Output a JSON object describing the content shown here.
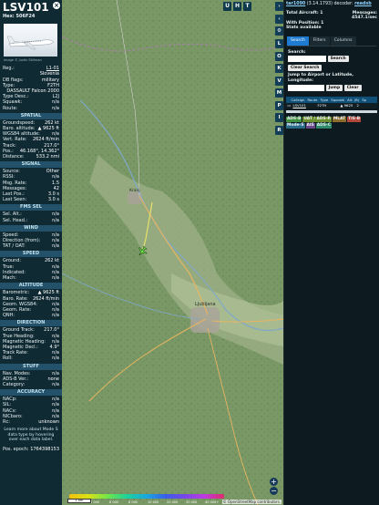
{
  "aircraft": {
    "callsign": "LSV101",
    "hex_line": "Hex: 506F24",
    "photo_credit": "Image © Justin Stillman",
    "reg_label": "Reg.:",
    "reg": "L1-01",
    "country": "Slovenia",
    "dbflags_label": "DB flags:",
    "dbflags": "military",
    "type_label": "Type:",
    "type": "F2TH",
    "model": "DASSAULT Falcon 2000",
    "typedesc_label": "Type Desc.:",
    "typedesc": "L2J",
    "squawk_label": "Squawk:",
    "squawk": "n/a",
    "route_label": "Route:",
    "route": "n/a"
  },
  "spatial": {
    "title": "SPATIAL",
    "rows": [
      {
        "k": "Groundspeed:",
        "v": "262 kt"
      },
      {
        "k": "Baro. altitude:",
        "v": "▲ 9625 ft"
      },
      {
        "k": "WGS84 altitude:",
        "v": "n/a"
      },
      {
        "k": "Vert. Rate:",
        "v": "2624 ft/min"
      },
      {
        "k": "Track:",
        "v": "217.0°"
      },
      {
        "k": "Pos.:",
        "v": "46.168°, 14.362°"
      },
      {
        "k": "Distance:",
        "v": "533.2 nmi"
      }
    ]
  },
  "signal": {
    "title": "SIGNAL",
    "rows": [
      {
        "k": "Source:",
        "v": "Other"
      },
      {
        "k": "RSSI:",
        "v": "n/a"
      },
      {
        "k": "Msg. Rate:",
        "v": "1.5"
      },
      {
        "k": "Messages:",
        "v": "42"
      },
      {
        "k": "Last Pos.:",
        "v": "3.0 s"
      },
      {
        "k": "Last Seen:",
        "v": "3.0 s"
      }
    ]
  },
  "fmssel": {
    "title": "FMS SEL",
    "rows": [
      {
        "k": "Sel. Alt.:",
        "v": "n/a"
      },
      {
        "k": "Sel. Head.:",
        "v": "n/a"
      }
    ]
  },
  "wind": {
    "title": "WIND",
    "rows": [
      {
        "k": "Speed:",
        "v": "n/a"
      },
      {
        "k": "Direction (from):",
        "v": "n/a"
      },
      {
        "k": "TAT / OAT:",
        "v": "n/a"
      }
    ]
  },
  "speed": {
    "title": "SPEED",
    "rows": [
      {
        "k": "Ground:",
        "v": "262 kt"
      },
      {
        "k": "True:",
        "v": "n/a"
      },
      {
        "k": "Indicated:",
        "v": "n/a"
      },
      {
        "k": "Mach:",
        "v": "n/a"
      }
    ]
  },
  "altitude": {
    "title": "ALTITUDE",
    "rows": [
      {
        "k": "Barometric:",
        "v": "▲ 9625 ft"
      },
      {
        "k": "Baro. Rate:",
        "v": "2624 ft/min"
      },
      {
        "k": "Geom. WGS84:",
        "v": "n/a"
      },
      {
        "k": "Geom. Rate:",
        "v": "n/a"
      },
      {
        "k": "QNH:",
        "v": "n/a"
      }
    ]
  },
  "direction": {
    "title": "DIRECTION",
    "rows": [
      {
        "k": "Ground Track:",
        "v": "217.0°"
      },
      {
        "k": "True Heading:",
        "v": "n/a"
      },
      {
        "k": "Magnetic Heading:",
        "v": "n/a"
      },
      {
        "k": "Magnetic Decl.:",
        "v": "4.9°"
      },
      {
        "k": "Track Rate:",
        "v": "n/a"
      },
      {
        "k": "Roll:",
        "v": "n/a"
      }
    ]
  },
  "stuff": {
    "title": "STUFF",
    "rows": [
      {
        "k": "Nav. Modes:",
        "v": "n/a"
      },
      {
        "k": "ADS-B Ver.:",
        "v": "none"
      },
      {
        "k": "Category:",
        "v": "n/a"
      }
    ]
  },
  "accuracy": {
    "title": "ACCURACY",
    "rows": [
      {
        "k": "NACp:",
        "v": "n/a"
      },
      {
        "k": "SIL:",
        "v": "n/a"
      },
      {
        "k": "NACv:",
        "v": "n/a"
      },
      {
        "k": "NICbaro:",
        "v": "n/a"
      },
      {
        "k": "Rc:",
        "v": "unknown"
      }
    ]
  },
  "footer": {
    "learn_more": "Learn more about Mode S data type by hovering over each data label.",
    "pos_epoch_label": "Pos. epoch:",
    "pos_epoch": "1764398153"
  },
  "map": {
    "top_buttons": [
      "U",
      "H",
      "T"
    ],
    "side_buttons": [
      "L",
      "O",
      "K",
      "V",
      "M",
      "P",
      "I",
      "R"
    ],
    "places": [
      "Kranj",
      "Ljubljana"
    ],
    "scale_text": "1 km",
    "attribution": "© OpenStreetMap contributors.",
    "zoom_in": "+",
    "zoom_out": "−",
    "alt_scale_labels": [
      "2 000",
      "4 000",
      "6 000",
      "8 000",
      "10 000",
      "20 000",
      "30 000",
      "40 000+"
    ]
  },
  "right": {
    "decoder_link": "tar1090",
    "version_text": "(3.14.1793) decoder:",
    "decoder_status": "readsb",
    "total_label": "Total Aircraft: 1",
    "messages_label": "Messages:",
    "messages_value": "4547.1/sec",
    "with_position": "With Position: 1",
    "stats": "Stats available",
    "tabs": [
      "Search",
      "Filters",
      "Columns"
    ],
    "search_label": "Search:",
    "search_button": "Search",
    "clear_search": "Clear Search",
    "jump_label": "Jump to Airport or Latitude, Longitude:",
    "jump_button": "Jump",
    "clear_button": "Clear",
    "columns": [
      "Callsign",
      "Route",
      "Type",
      "Squawk",
      "Alt. (ft)",
      "Sp"
    ],
    "table_rows": [
      {
        "callsign": "LSV101",
        "route": "",
        "type": "F2TH",
        "squawk": "",
        "alt": "▲ 9625",
        "speed": "2"
      }
    ],
    "tags": [
      "ADS-B",
      "UAT / ADS-R",
      "MLAT",
      "TIS-B",
      "Mode-S",
      "AIS",
      "ADS-C"
    ],
    "tag_colors": [
      "#3f8f3f",
      "#6b8f2d",
      "#8d6b2a",
      "#b0473a",
      "#2b6b8a",
      "#6a4a8a",
      "#2f8a6a"
    ]
  }
}
